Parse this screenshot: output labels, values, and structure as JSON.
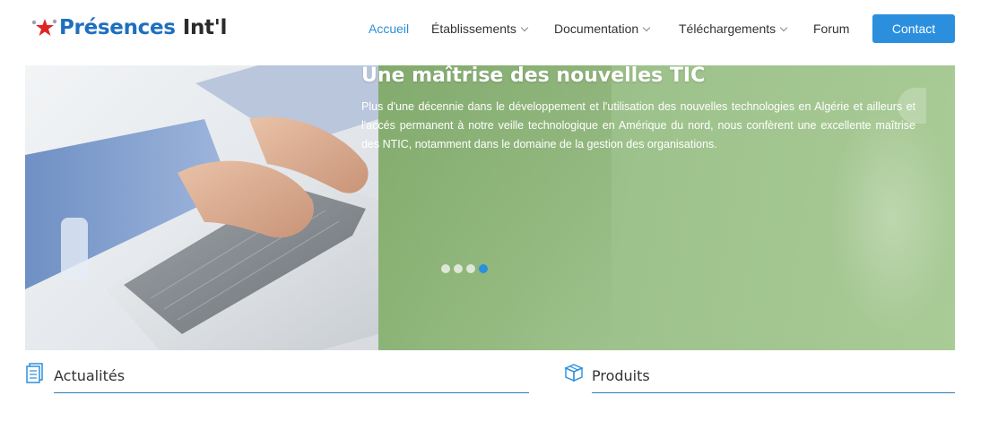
{
  "brand": {
    "name_part1": "Présences",
    "name_part2": "Int'l"
  },
  "nav": {
    "items": [
      {
        "label": "Accueil",
        "active": true,
        "dropdown": false
      },
      {
        "label": "Établissements",
        "active": false,
        "dropdown": true
      },
      {
        "label": "Documentation",
        "active": false,
        "dropdown": true
      },
      {
        "label": "Téléchargements",
        "active": false,
        "dropdown": true
      },
      {
        "label": "Forum",
        "active": false,
        "dropdown": false
      }
    ],
    "contact_label": "Contact"
  },
  "hero": {
    "title": "Une maîtrise des nouvelles TIC",
    "text": "Plus d'une décennie dans le développement et l'utilisation des nouvelles technologies en Algérie et ailleurs et l'accés permanent à notre veille technologique en Amérique du nord, nous confèrent une excellente maîtrise des NTIC, notamment dans le domaine de la gestion des organisations.",
    "slide_count": 4,
    "active_slide": 4
  },
  "sections": [
    {
      "title": "Actualités",
      "icon": "news-icon"
    },
    {
      "title": "Produits",
      "icon": "package-icon"
    }
  ],
  "colors": {
    "accent": "#2b8fde",
    "hero_green": "#96bd84",
    "brand_blue": "#1f6fbf"
  }
}
